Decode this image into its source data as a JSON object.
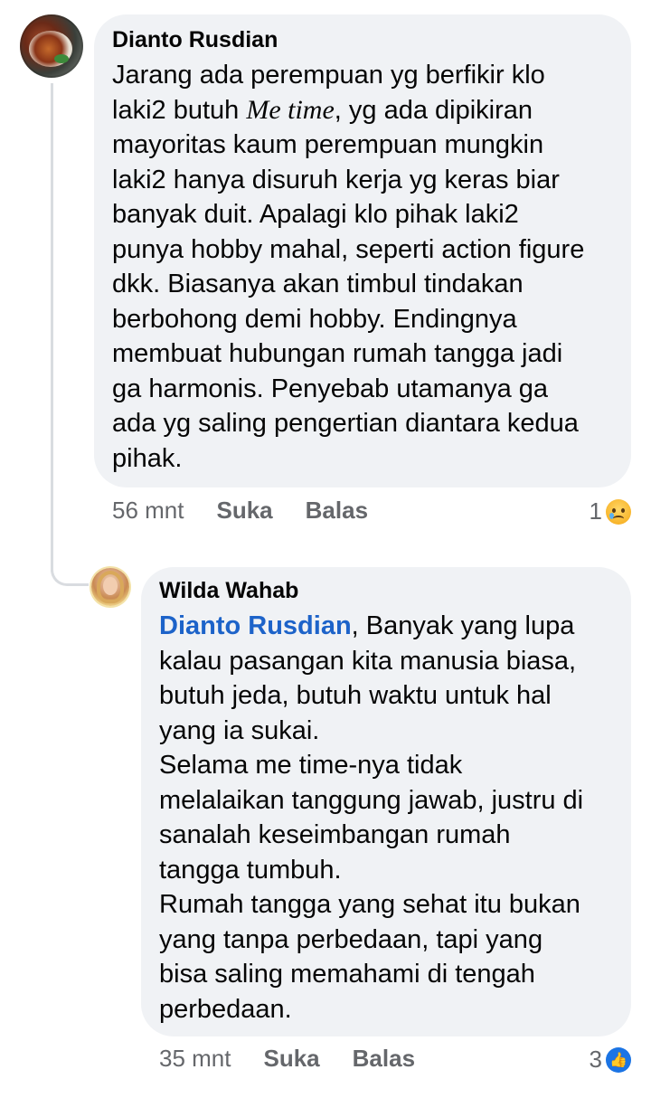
{
  "comments": [
    {
      "author": "Dianto Rusdian",
      "lines": [
        "Jarang ada perempuan yg berfikir klo",
        "laki2 butuh ",
        "Me time",
        ", yg ada dipikiran",
        "mayoritas kaum perempuan mungkin",
        "laki2 hanya disuruh kerja yg keras biar",
        "banyak duit. Apalagi klo pihak laki2",
        "punya hobby mahal, seperti action figure",
        "dkk. Biasanya akan timbul tindakan",
        "berbohong demi hobby. Endingnya",
        "membuat hubungan rumah tangga jadi",
        "ga harmonis. Penyebab utamanya ga",
        "ada yg saling pengertian diantara kedua",
        "pihak."
      ],
      "time": "56 mnt",
      "like_label": "Suka",
      "reply_label": "Balas",
      "reaction_count": "1",
      "reaction_icon": "sad-face-icon"
    },
    {
      "author": "Wilda Wahab",
      "mention": "Dianto Rusdian",
      "lines": [
        ", Banyak yang lupa",
        "kalau pasangan kita manusia biasa,",
        "butuh jeda, butuh waktu untuk hal",
        "yang ia sukai.",
        "Selama me time-nya tidak",
        "melalaikan tanggung jawab, justru di",
        "sanalah keseimbangan rumah",
        "tangga tumbuh.",
        "Rumah tangga yang sehat itu bukan",
        "yang tanpa perbedaan, tapi yang",
        "bisa saling memahami di tengah",
        "perbedaan."
      ],
      "time": "35 mnt",
      "like_label": "Suka",
      "reply_label": "Balas",
      "reaction_count": "3",
      "reaction_icon": "like-icon"
    }
  ],
  "colors": {
    "bubble": "#f0f2f5",
    "meta_text": "#65676b",
    "mention": "#1d63c9",
    "like_blue": "#1b74e4"
  }
}
